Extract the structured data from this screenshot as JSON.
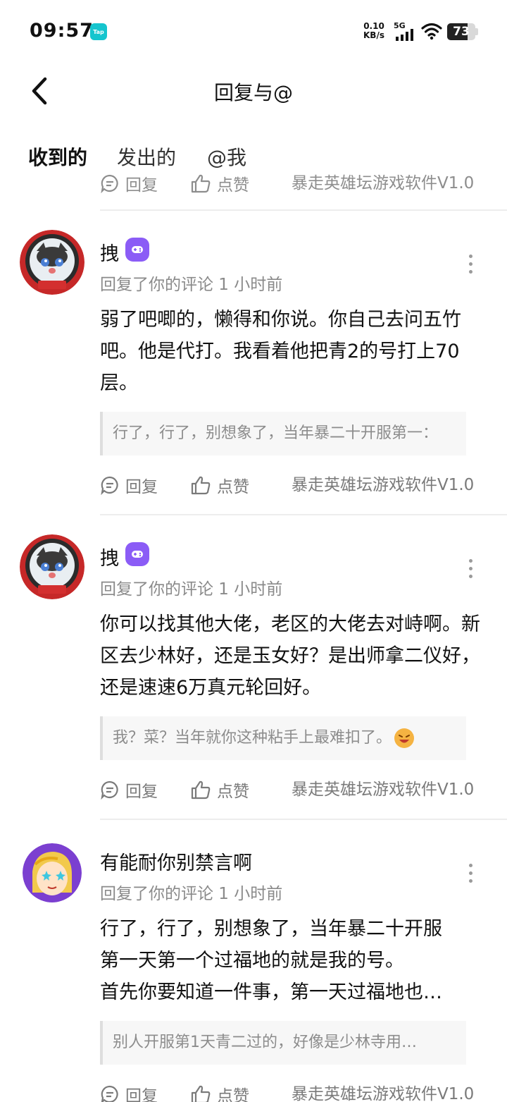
{
  "status_bar": {
    "time": "09:57",
    "app_badge": "Tap",
    "net_speed_value": "0.10",
    "net_speed_unit": "KB/s",
    "network": "5G",
    "battery": "73"
  },
  "nav": {
    "title": "回复与@"
  },
  "tabs": [
    {
      "label": "收到的",
      "active": true
    },
    {
      "label": "发出的",
      "active": false
    },
    {
      "label": "@我",
      "active": false
    }
  ],
  "partial_actions": {
    "reply": "回复",
    "like": "点赞",
    "source": "暴走英雄坛游戏软件V1.0"
  },
  "items": [
    {
      "username": "拽",
      "meta": "回复了你的评论 1 小时前",
      "content": "弱了吧唧的，懒得和你说。你自己去问五竹吧。他是代打。我看着他把青2的号打上70层。",
      "quote": "行了，行了，别想象了，当年暴二十开服第一：",
      "reply": "回复",
      "like": "点赞",
      "source": "暴走英雄坛游戏软件V1.0"
    },
    {
      "username": "拽",
      "meta": "回复了你的评论 1 小时前",
      "content": "你可以找其他大佬，老区的大佬去对峙啊。新区去少林好，还是玉女好？是出师拿二仪好，还是速速6万真元轮回好。",
      "quote": "我？菜？当年就你这种粘手上最难扣了。",
      "reply": "回复",
      "like": "点赞",
      "source": "暴走英雄坛游戏软件V1.0"
    },
    {
      "username": "有能耐你别禁言啊",
      "meta": "回复了你的评论 1 小时前",
      "content_lines": [
        "行了，行了，别想象了，当年暴二十开服",
        "第一天第一个过福地的就是我的号。",
        "首先你要知道一件事，第一天过福地也…"
      ],
      "quote": "别人开服第1天青二过的，好像是少林寺用…",
      "reply": "回复",
      "like": "点赞",
      "source": "暴走英雄坛游戏软件V1.0"
    }
  ],
  "colors": {
    "accent": "#15c5ce",
    "badge": "#8b5cf6",
    "muted": "#8a8a8a"
  }
}
